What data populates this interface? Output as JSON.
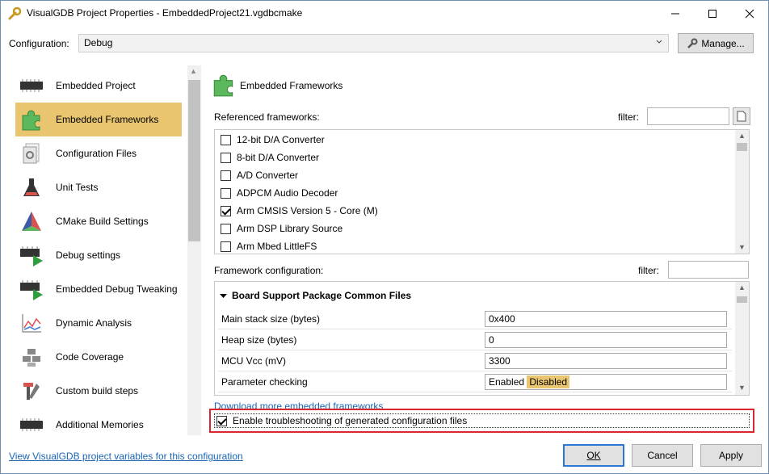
{
  "window": {
    "title": "VisualGDB Project Properties - EmbeddedProject21.vgdbcmake"
  },
  "configuration": {
    "label": "Configuration:",
    "value": "Debug",
    "manage_label": "Manage..."
  },
  "sidebar": {
    "items": [
      {
        "label": "Embedded Project",
        "icon": "chip-icon"
      },
      {
        "label": "Embedded Frameworks",
        "icon": "puzzle-icon",
        "selected": true
      },
      {
        "label": "Configuration Files",
        "icon": "config-files-icon"
      },
      {
        "label": "Unit Tests",
        "icon": "flask-icon"
      },
      {
        "label": "CMake Build Settings",
        "icon": "cmake-icon"
      },
      {
        "label": "Debug settings",
        "icon": "debug-chip-icon"
      },
      {
        "label": "Embedded Debug Tweaking",
        "icon": "debug-chip-icon"
      },
      {
        "label": "Dynamic Analysis",
        "icon": "chart-icon"
      },
      {
        "label": "Code Coverage",
        "icon": "coverage-icon"
      },
      {
        "label": "Custom build steps",
        "icon": "tools-icon"
      },
      {
        "label": "Additional Memories",
        "icon": "chip-icon"
      }
    ]
  },
  "main": {
    "title": "Embedded Frameworks",
    "referenced_label": "Referenced frameworks:",
    "filter_label": "filter:",
    "frameworks": [
      {
        "label": "12-bit D/A Converter",
        "checked": false
      },
      {
        "label": "8-bit D/A Converter",
        "checked": false
      },
      {
        "label": "A/D Converter",
        "checked": false
      },
      {
        "label": "ADPCM Audio Decoder",
        "checked": false
      },
      {
        "label": "Arm CMSIS Version 5 - Core (M)",
        "checked": true
      },
      {
        "label": "Arm DSP Library Source",
        "checked": false
      },
      {
        "label": "Arm Mbed LittleFS",
        "checked": false
      }
    ],
    "framework_config_label": "Framework configuration:",
    "filter2_label": "filter:",
    "group_title": "Board Support Package Common Files",
    "rows": [
      {
        "label": "Main stack size (bytes)",
        "value": "0x400"
      },
      {
        "label": "Heap size (bytes)",
        "value": "0"
      },
      {
        "label": "MCU Vcc (mV)",
        "value": "3300"
      },
      {
        "label": "Parameter checking",
        "option_a": "Enabled",
        "option_b": "Disabled"
      }
    ],
    "download_link": "Download more embedded frameworks",
    "troubleshoot_label": "Enable troubleshooting of generated configuration files"
  },
  "footer": {
    "vars_link": "View VisualGDB project variables for this configuration",
    "ok": "OK",
    "cancel": "Cancel",
    "apply": "Apply"
  }
}
